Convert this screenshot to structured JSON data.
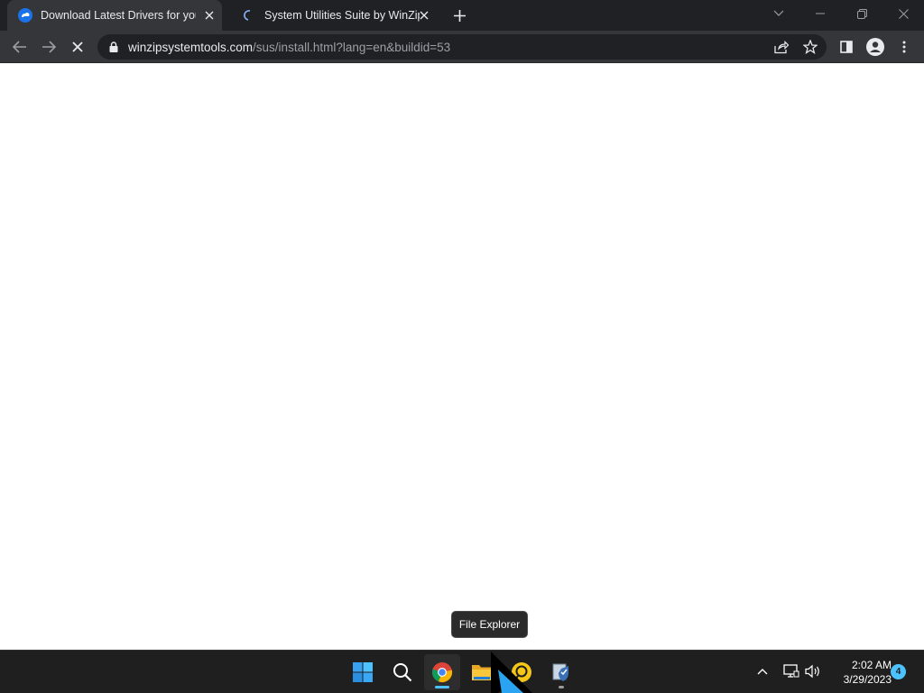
{
  "browser": {
    "tabs": [
      {
        "title": "Download Latest Drivers for your",
        "favicon": "cloud-logo-icon",
        "active": true
      },
      {
        "title": "System Utilities Suite by WinZip",
        "favicon": "loading-spinner-icon",
        "active": false
      }
    ],
    "address_bar": {
      "host": "winzipsystemtools.com",
      "path": "/sus/install.html?lang=en&buildid=53"
    },
    "page_status": "loading"
  },
  "tooltip": {
    "text": "File Explorer"
  },
  "taskbar": {
    "apps": [
      {
        "name": "start",
        "icon": "windows-start-icon"
      },
      {
        "name": "search",
        "icon": "search-icon"
      },
      {
        "name": "chrome",
        "icon": "chrome-icon",
        "running": true,
        "active": true
      },
      {
        "name": "file-explorer",
        "icon": "folder-icon"
      },
      {
        "name": "app",
        "icon": "yellow-circle-app-icon"
      },
      {
        "name": "installer",
        "icon": "shield-setup-icon",
        "running": true
      }
    ],
    "tray": {
      "time": "2:02 AM",
      "date": "3/29/2023",
      "notification_count": "4"
    }
  },
  "colors": {
    "chrome_dark": "#202124",
    "toolbar": "#35363a",
    "taskbar": "#1f1f1f",
    "accent": "#4cc2ff"
  }
}
